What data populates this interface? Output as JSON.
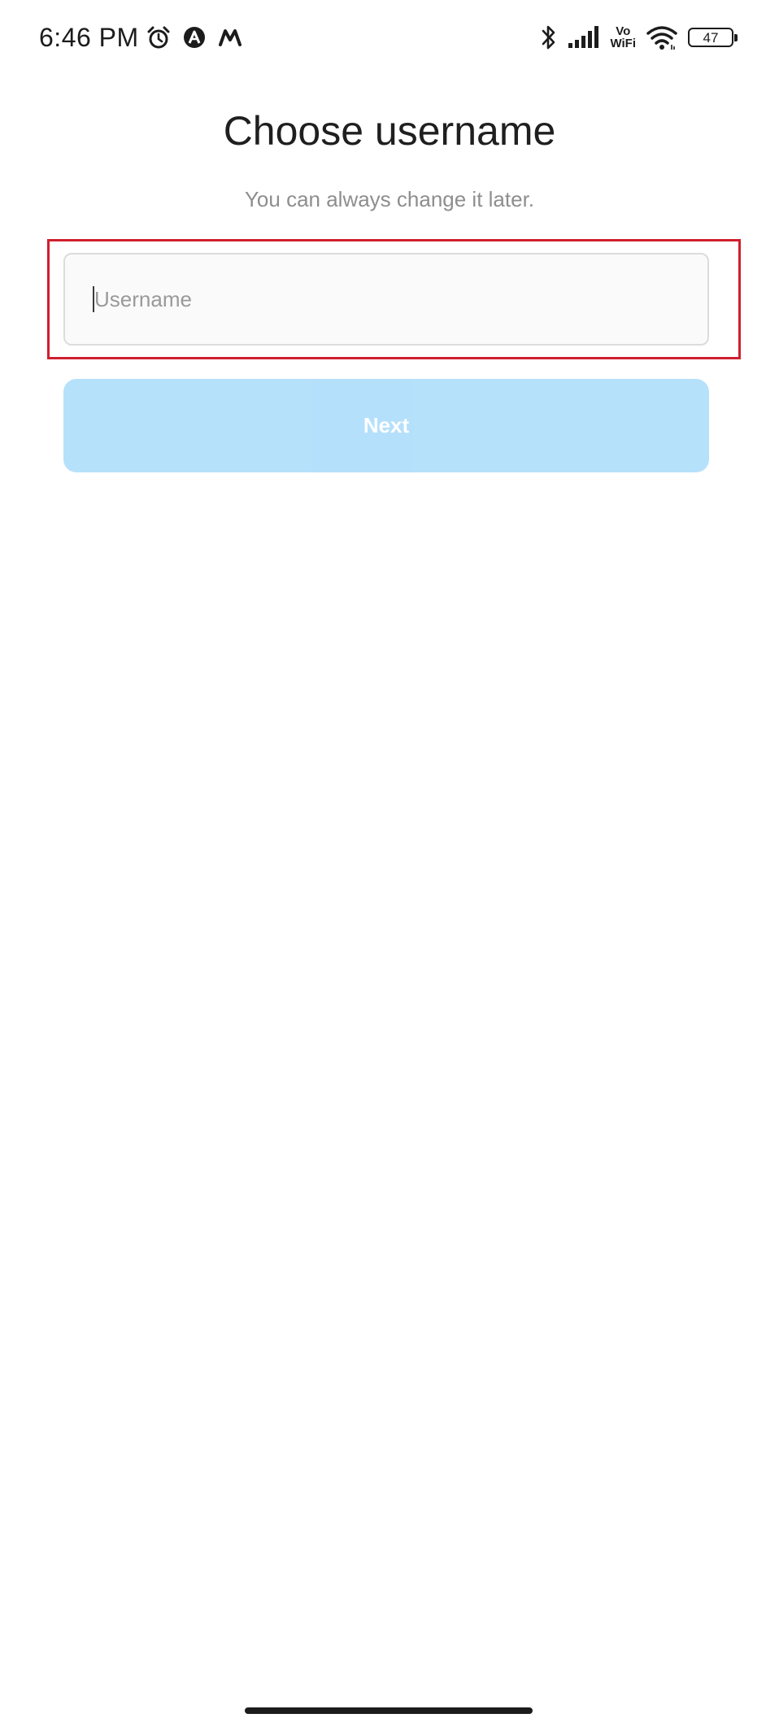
{
  "status_bar": {
    "time": "6:46 PM",
    "left_icons": [
      "alarm-icon",
      "app-notification-a-icon",
      "app-notification-m-icon"
    ],
    "right_icons": [
      "bluetooth-icon",
      "signal-icon",
      "vowifi-icon",
      "wifi-icon",
      "battery-icon"
    ],
    "vowifi_top": "Vo",
    "vowifi_bottom": "WiFi",
    "battery_level": "47"
  },
  "main": {
    "title": "Choose username",
    "subtitle": "You can always change it later.",
    "username_field": {
      "placeholder": "Username",
      "value": ""
    },
    "next_label": "Next"
  },
  "colors": {
    "next_button_bg": "#b2dffb",
    "highlight_border": "#d0202f",
    "field_bg": "#fafafa",
    "subtitle_text": "#8e8e8e"
  }
}
